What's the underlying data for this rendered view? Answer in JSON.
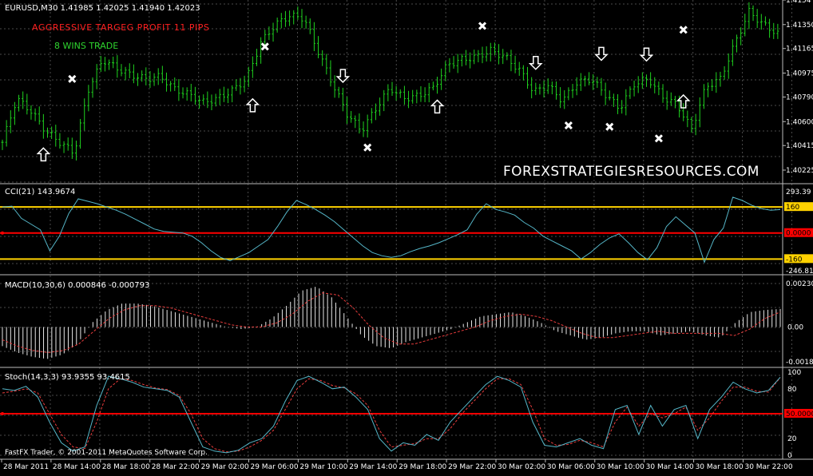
{
  "window": {
    "footer": "FastFX Trader, © 2001-2011 MetaQuotes Software Corp."
  },
  "colors": {
    "background": "#000000",
    "grid": "#4a4a4a",
    "axis_text": "#ffffff",
    "price_bar": "#1fd21f",
    "cci_line": "#55b6c8",
    "level_yellow": "#ffd200",
    "level_red": "#ff0000",
    "macd_hist": "#e8e8e8",
    "macd_signal": "#e83c3c",
    "stoch_main": "#55b6c8",
    "stoch_signal": "#e83c3c",
    "buy_arrow": "#ffffff",
    "exit_mark": "#ffffff",
    "overlay_red": "#ff2020",
    "overlay_green": "#2fd52f"
  },
  "chart_data": [
    {
      "type": "ohlc",
      "pane": "price",
      "title": "EURUSD,M30  1.41985 1.42025 1.41940 1.42023",
      "overlay_title": "AGGRESSIVE TARGEG PROFIT 11 PIPS",
      "overlay_subtitle": "8  WINS TRADE",
      "watermark": "FOREXSTRATEGIESRESOURCES.COM",
      "ylim": [
        1.4012,
        1.4154
      ],
      "y_ticks": [
        1.4154,
        1.4135,
        1.41165,
        1.40975,
        1.4079,
        1.406,
        1.40415,
        1.40225
      ],
      "y_tick_labels": [
        "1.4154",
        "1.41350",
        "1.41165",
        "1.40975",
        "1.40790",
        "1.40600",
        "1.40415",
        "1.40225"
      ],
      "x_tick_labels": [
        "28 Mar 2011",
        "28 Mar 14:00",
        "28 Mar 18:00",
        "28 Mar 22:00",
        "29 Mar 02:00",
        "29 Mar 06:00",
        "29 Mar 10:00",
        "29 Mar 14:00",
        "29 Mar 18:00",
        "29 Mar 22:00",
        "30 Mar 02:00",
        "30 Mar 06:00",
        "30 Mar 10:00",
        "30 Mar 14:00",
        "30 Mar 18:00",
        "30 Mar 22:00"
      ],
      "close_path": [
        1.4044,
        1.4078,
        1.4068,
        1.4053,
        1.4044,
        1.4036,
        1.4085,
        1.4108,
        1.4101,
        1.4096,
        1.4093,
        1.4095,
        1.4085,
        1.4081,
        1.4075,
        1.4078,
        1.4084,
        1.4093,
        1.4121,
        1.4135,
        1.4142,
        1.414,
        1.4114,
        1.4089,
        1.4066,
        1.4053,
        1.407,
        1.4086,
        1.4078,
        1.408,
        1.4086,
        1.4104,
        1.4108,
        1.411,
        1.4115,
        1.411,
        1.41,
        1.4083,
        1.4088,
        1.4076,
        1.409,
        1.4093,
        1.4081,
        1.407,
        1.4089,
        1.4093,
        1.4079,
        1.4073,
        1.4054,
        1.4087,
        1.4093,
        1.412,
        1.4145,
        1.4135,
        1.4128
      ],
      "arrows_up": [
        {
          "label": "buy",
          "price": 1.4034,
          "bar": 10
        },
        {
          "label": "buy",
          "price": 1.4072,
          "bar": 61
        },
        {
          "label": "buy",
          "price": 1.4071,
          "bar": 106
        },
        {
          "label": "buy",
          "price": 1.4075,
          "bar": 166
        }
      ],
      "arrows_down": [
        {
          "label": "sell",
          "price": 1.4096,
          "bar": 83
        },
        {
          "label": "sell",
          "price": 1.4106,
          "bar": 130
        },
        {
          "label": "sell",
          "price": 1.4113,
          "bar": 146
        },
        {
          "label": "sell",
          "price": 1.41125,
          "bar": 157
        }
      ],
      "exit_marks": [
        {
          "price": 1.4093,
          "bar": 17
        },
        {
          "price": 1.4118,
          "bar": 64
        },
        {
          "price": 1.404,
          "bar": 89
        },
        {
          "price": 1.4134,
          "bar": 117
        },
        {
          "price": 1.4057,
          "bar": 138
        },
        {
          "price": 1.4056,
          "bar": 148
        },
        {
          "price": 1.4047,
          "bar": 160
        },
        {
          "price": 1.4131,
          "bar": 166
        }
      ]
    },
    {
      "type": "line",
      "pane": "cci",
      "title": "CCI(21) 143.9674",
      "ylim": [
        -246.818,
        293.39
      ],
      "y_tick_labels": [
        "293.39",
        "-246.818"
      ],
      "levels": [
        {
          "value": 160,
          "label": "160",
          "color": "yellow"
        },
        {
          "value": 0,
          "label": "0.0000",
          "color": "red"
        },
        {
          "value": -160,
          "label": "-160",
          "color": "yellow"
        }
      ],
      "series": [
        {
          "values": [
            160,
            165,
            90,
            55,
            20,
            -110,
            -20,
            120,
            210,
            195,
            180,
            160,
            140,
            115,
            85,
            55,
            25,
            10,
            5,
            0,
            -20,
            -60,
            -110,
            -150,
            -170,
            -145,
            -120,
            -80,
            -40,
            40,
            130,
            200,
            175,
            145,
            110,
            70,
            20,
            -30,
            -80,
            -120,
            -140,
            -150,
            -140,
            -115,
            -95,
            -80,
            -60,
            -35,
            -10,
            20,
            115,
            180,
            145,
            130,
            110,
            65,
            30,
            -20,
            -50,
            -80,
            -110,
            -160,
            -120,
            -70,
            -30,
            -5,
            -60,
            -120,
            -165,
            -90,
            40,
            100,
            50,
            0,
            -180,
            -40,
            30,
            220,
            200,
            170,
            150,
            140,
            143.9674
          ]
        }
      ]
    },
    {
      "type": "bar",
      "pane": "macd",
      "title": "MACD(10,30,6) 0.000846 -0.000793",
      "ylim": [
        -0.00182,
        0.0023
      ],
      "y_tick_labels": [
        "0.00230",
        "0.00",
        "-0.00182"
      ],
      "series": [
        {
          "name": "MACD",
          "values": [
            -0.0009,
            -0.0012,
            -0.0014,
            -0.0015,
            -0.0013,
            -0.0008,
            0.0002,
            0.0008,
            0.0011,
            0.0011,
            0.001,
            0.0008,
            0.0006,
            0.0004,
            0.0002,
            0.0,
            -0.0001,
            0.0,
            0.0004,
            0.001,
            0.0017,
            0.0019,
            0.0014,
            0.0005,
            -0.0004,
            -0.0009,
            -0.001,
            -0.0007,
            -0.0005,
            -0.0003,
            -0.0001,
            0.0002,
            0.0005,
            0.0006,
            0.0007,
            0.0005,
            0.0002,
            -0.0002,
            -0.0004,
            -0.0006,
            -0.0005,
            -0.0003,
            -0.0002,
            -0.0002,
            -0.0004,
            -0.0003,
            -0.0002,
            -0.0004,
            -0.0005,
            0.0002,
            0.0007,
            0.0008,
            0.000846
          ]
        },
        {
          "name": "Signal",
          "values": [
            -0.0006,
            -0.0009,
            -0.0011,
            -0.0012,
            -0.0011,
            -0.0008,
            -0.0002,
            0.0004,
            0.0008,
            0.001,
            0.001,
            0.0009,
            0.0007,
            0.0005,
            0.0003,
            0.0001,
            -0.0,
            -0.0,
            0.0002,
            0.0006,
            0.0012,
            0.0016,
            0.0015,
            0.0009,
            0.0001,
            -0.0005,
            -0.0008,
            -0.0008,
            -0.0006,
            -0.0004,
            -0.0002,
            0.0,
            0.0003,
            0.0005,
            0.0006,
            0.0005,
            0.0003,
            0.0,
            -0.0003,
            -0.0005,
            -0.0005,
            -0.0004,
            -0.0003,
            -0.0002,
            -0.0003,
            -0.0003,
            -0.0003,
            -0.0003,
            -0.0004,
            -0.0001,
            0.0004,
            0.0007,
            -0.000793
          ]
        }
      ]
    },
    {
      "type": "line",
      "pane": "stochastic",
      "title": "Stoch(14,3,3) 93.9355 93.4615",
      "ylim": [
        0,
        100
      ],
      "y_tick_labels": [
        "100",
        "80",
        "50.0000",
        "20",
        "0"
      ],
      "levels": [
        {
          "value": 50,
          "label": "50.0000",
          "color": "red"
        }
      ],
      "series": [
        {
          "name": "Main",
          "values": [
            80,
            78,
            83,
            70,
            40,
            15,
            5,
            10,
            60,
            95,
            92,
            88,
            82,
            80,
            78,
            70,
            40,
            10,
            5,
            3,
            6,
            15,
            20,
            35,
            65,
            90,
            95,
            88,
            80,
            82,
            70,
            55,
            20,
            5,
            15,
            12,
            25,
            18,
            40,
            55,
            70,
            85,
            95,
            90,
            82,
            40,
            12,
            10,
            15,
            20,
            12,
            8,
            55,
            60,
            25,
            60,
            35,
            55,
            60,
            20,
            55,
            70,
            88,
            80,
            75,
            78,
            93.9355
          ]
        },
        {
          "name": "Signal",
          "values": [
            75,
            77,
            80,
            75,
            50,
            25,
            10,
            8,
            40,
            80,
            92,
            90,
            85,
            81,
            79,
            72,
            50,
            20,
            8,
            4,
            5,
            10,
            18,
            30,
            55,
            80,
            92,
            90,
            84,
            81,
            74,
            60,
            30,
            10,
            12,
            14,
            20,
            20,
            32,
            50,
            65,
            80,
            92,
            92,
            85,
            55,
            20,
            12,
            13,
            18,
            15,
            10,
            40,
            58,
            35,
            50,
            45,
            50,
            58,
            30,
            45,
            65,
            82,
            82,
            77,
            76,
            93.4615
          ]
        }
      ]
    }
  ]
}
